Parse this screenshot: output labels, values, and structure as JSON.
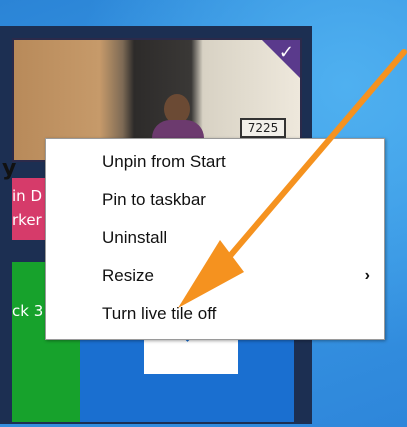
{
  "photo_tile": {
    "door_number": "7225",
    "check_icon": "checkmark-icon"
  },
  "pink_tile": {
    "line1": "in D",
    "line2": "rker"
  },
  "green_tile": {
    "text": "ck 3"
  },
  "left_strip": {
    "text": "y"
  },
  "context_menu": {
    "items": [
      {
        "label": "Unpin from Start"
      },
      {
        "label": "Pin to taskbar"
      },
      {
        "label": "Uninstall"
      },
      {
        "label": "Resize",
        "submenu_glyph": "›"
      },
      {
        "label": "Turn live tile off"
      }
    ]
  },
  "annotation": {
    "arrow_color": "#f5921f"
  }
}
